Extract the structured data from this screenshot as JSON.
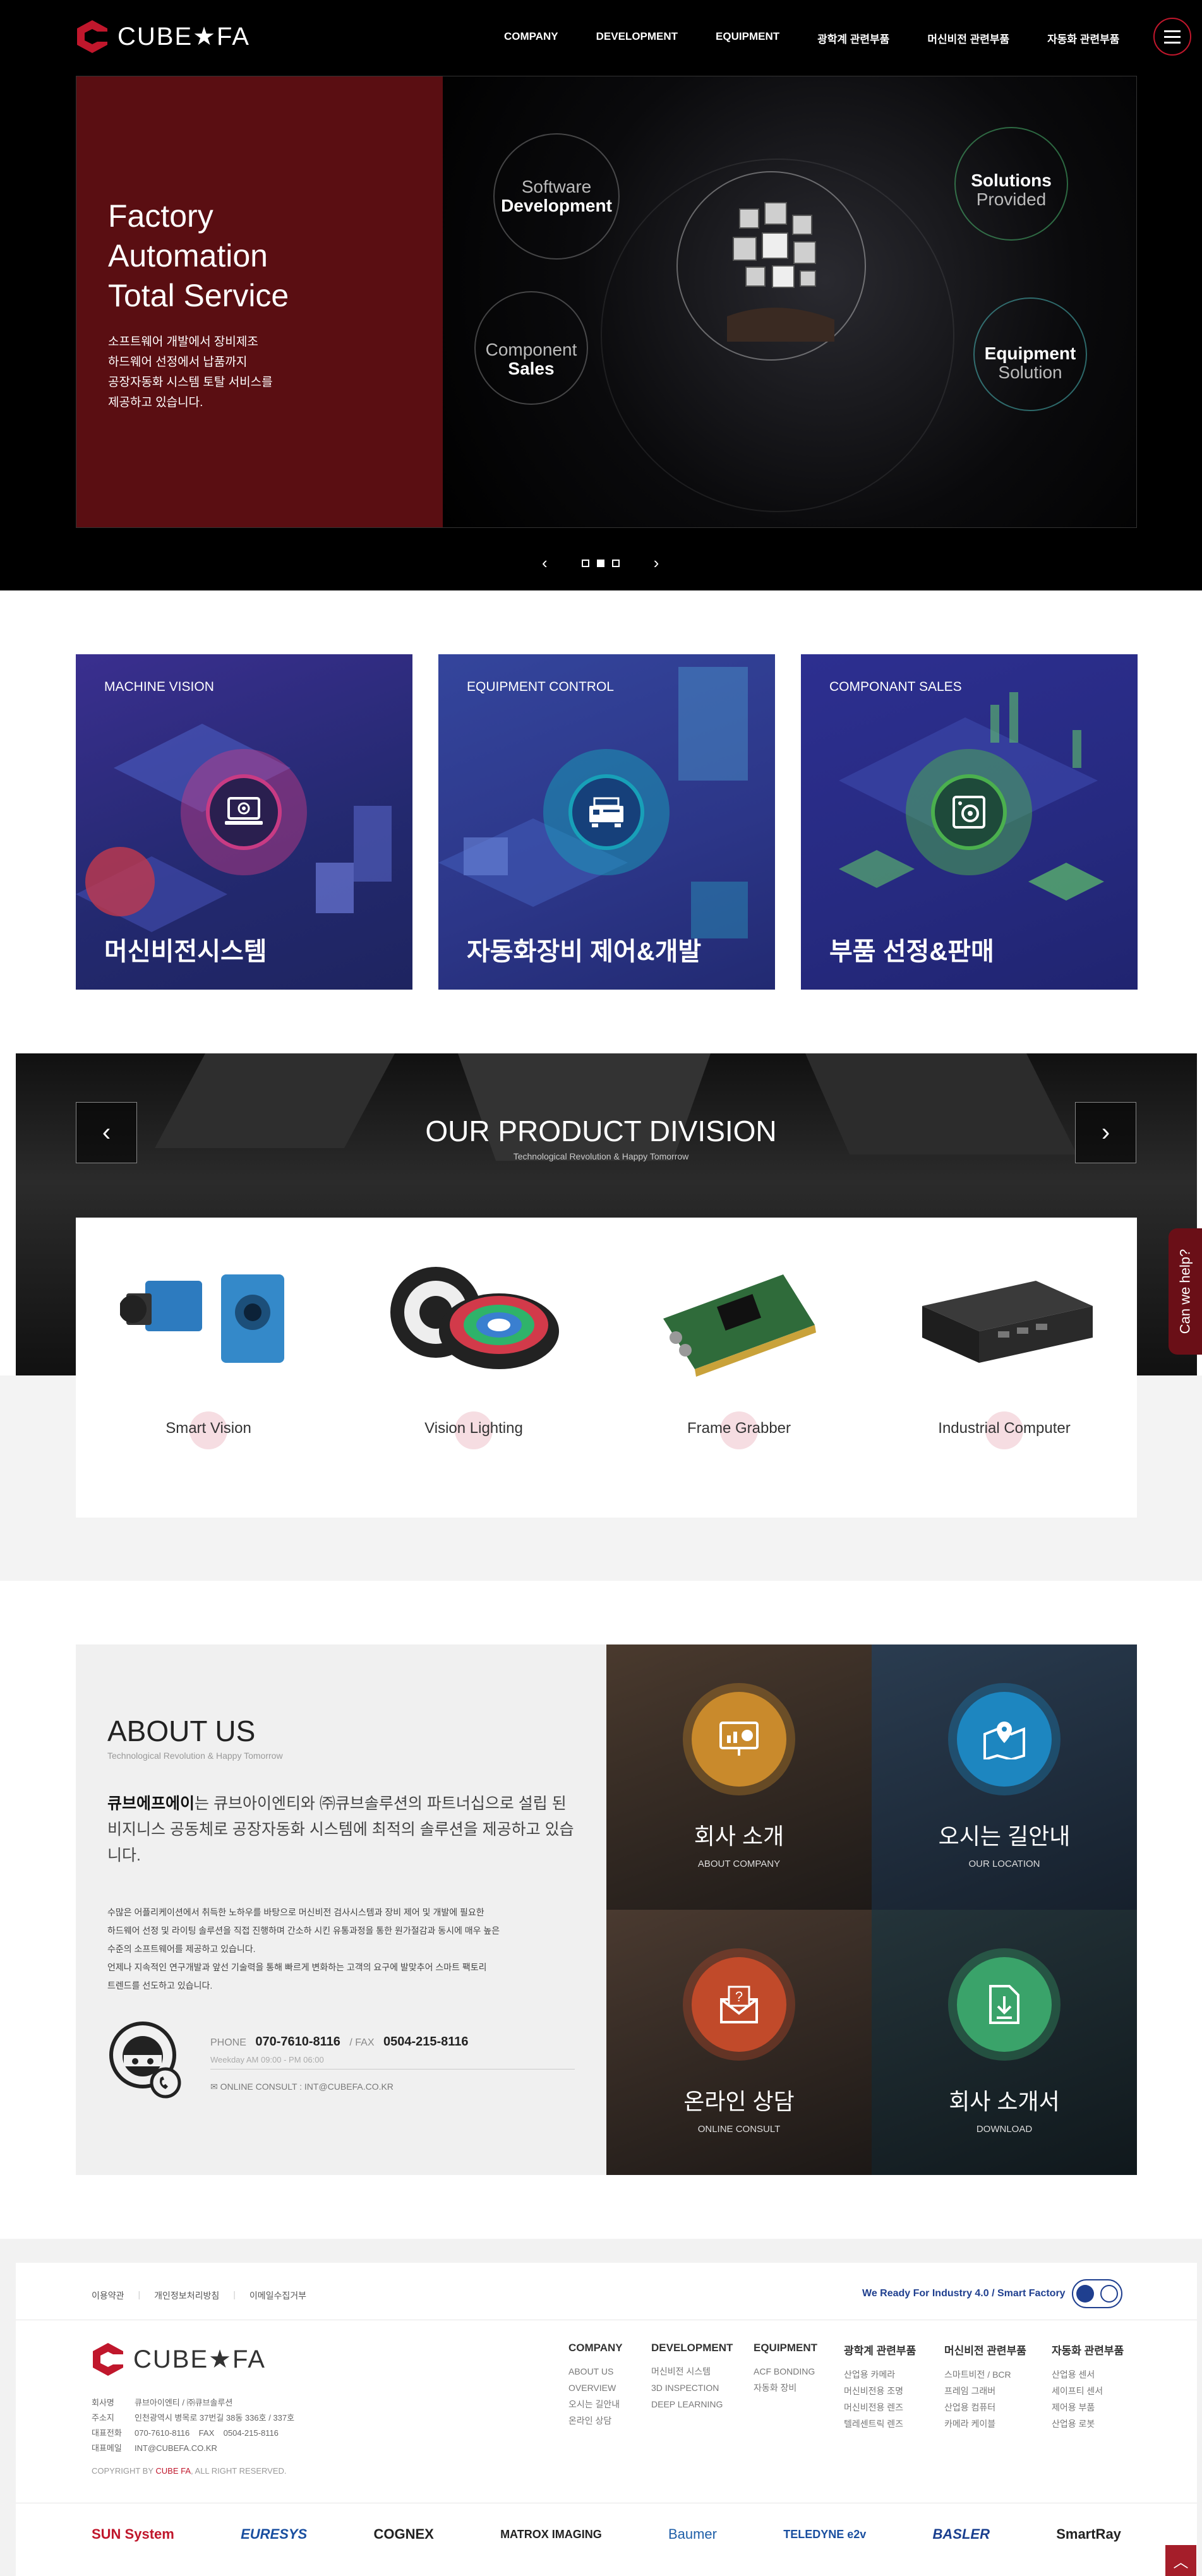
{
  "header": {
    "logo_text": "CUBE★FA",
    "nav": [
      "COMPANY",
      "DEVELOPMENT",
      "EQUIPMENT",
      "광학계 관련부품",
      "머신비전 관련부품",
      "자동화 관련부품"
    ]
  },
  "hero": {
    "title_lines": [
      "Factory",
      "Automation",
      "Total Service"
    ],
    "desc_lines": [
      "소프트웨어 개발에서 장비제조",
      "하드웨어 선정에서 납품까지",
      "공장자동화 시스템 토탈 서비스를",
      "제공하고 있습니다."
    ],
    "labels": {
      "software": {
        "light": "Software",
        "bold": "Development"
      },
      "solutions": {
        "light": "Solutions",
        "sub": "Provided"
      },
      "component": {
        "light": "Component",
        "bold": "Sales"
      },
      "equipment": {
        "light": "Equipment",
        "sub": "Solution"
      }
    },
    "slide_count": 3,
    "active_slide": 2
  },
  "services": [
    {
      "tag": "MACHINE VISION",
      "title": "머신비전시스템",
      "color": "#2a2f7e",
      "accent": "#c83b84"
    },
    {
      "tag": "EQUIPMENT CONTROL",
      "title": "자동화장비 제어&개발",
      "color": "#2d3a8c",
      "accent": "#18a0b8"
    },
    {
      "tag": "COMPONANT SALES",
      "title": "부품 선정&판매",
      "color": "#262c80",
      "accent": "#4bb04e"
    }
  ],
  "product_division": {
    "title": "OUR PRODUCT DIVISION",
    "subtitle": "Technological Revolution & Happy Tomorrow",
    "products": [
      "Smart Vision",
      "Vision Lighting",
      "Frame Grabber",
      "Industrial Computer"
    ]
  },
  "help_tab": "Can we help?",
  "about": {
    "title": "ABOUT US",
    "subtitle": "Technological Revolution & Happy Tomorrow",
    "lead_bold": "큐브에프에이",
    "lead_rest": "는 큐브아이엔티와 ㈜큐브솔루션의 파트너십으로 설립 된 비지니스 공동체로 공장자동화 시스템에 최적의 솔루션을 제공하고 있습니다.",
    "body_lines": [
      "수많은 어플리케이션에서 취득한 노하우를 바탕으로 머신비전 검사시스템과 장비 제어 및 개발에 필요한",
      "하드웨어 선정 및 라이팅 솔루션을 직접 진행하며 간소하 시킨 유통과정을 통한 원가절감과 동시에 매우 높은",
      "수준의 소프트웨어를 제공하고 있습니다.",
      "언제나 지속적인 연구개발과 앞선 기술력을 통해 빠르게 변화하는 고객의 요구에 발맞추어 스마트 팩토리",
      "트렌드를 선도하고 있습니다."
    ],
    "phone_label": "PHONE",
    "phone": "070-7610-8116",
    "fax_label": "/ FAX",
    "fax": "0504-215-8116",
    "hours": "Weekday AM 09:00 - PM 06:00",
    "consult": "ONLINE CONSULT : INT@CUBEFA.CO.KR",
    "tiles": [
      {
        "title": "회사 소개",
        "sub": "ABOUT COMPANY",
        "icon": "presentation-icon",
        "ring": "#c98a2c",
        "bg": "#3b2c20"
      },
      {
        "title": "오시는 길안내",
        "sub": "OUR LOCATION",
        "icon": "map-pin-icon",
        "ring": "#1d86c0",
        "bg": "#1c2c3d"
      },
      {
        "title": "온라인 상담",
        "sub": "ONLINE CONSULT",
        "icon": "mail-question-icon",
        "ring": "#c14a2a",
        "bg": "#3a2a22"
      },
      {
        "title": "회사 소개서",
        "sub": "DOWNLOAD",
        "icon": "download-file-icon",
        "ring": "#3aa36a",
        "bg": "#1d2c2a"
      }
    ]
  },
  "footer": {
    "links": [
      "이용약관",
      "개인정보처리방침",
      "이메일수집거부"
    ],
    "tagline": "We Ready For Industry 4.0 / Smart Factory",
    "logo_text": "CUBE★FA",
    "info": [
      {
        "k": "회사명",
        "v": "큐브아이엔티 / ㈜큐브솔루션"
      },
      {
        "k": "주소지",
        "v": "인천광역시 병목로 37번길 38동 336호 / 337호"
      },
      {
        "k": "대표전화",
        "v": "070-7610-8116    FAX    0504-215-8116"
      },
      {
        "k": "대표메일",
        "v": "INT@CUBEFA.CO.KR"
      }
    ],
    "copyright_pre": "COPYRIGHT BY ",
    "copyright_brand": "CUBE FA",
    "copyright_post": ", ALL RIGHT RESERVED.",
    "columns": [
      {
        "h": "COMPANY",
        "items": [
          "ABOUT US",
          "OVERVIEW",
          "오시는 길안내",
          "온라인 상담"
        ]
      },
      {
        "h": "DEVELOPMENT",
        "items": [
          "머신비전 시스템",
          "3D INSPECTION",
          "DEEP LEARNING"
        ]
      },
      {
        "h": "EQUIPMENT",
        "items": [
          "ACF BONDING",
          "자동화 장비"
        ]
      },
      {
        "h": "광학계 관련부품",
        "items": [
          "산업용 카메라",
          "머신비전용 조명",
          "머신비전용 렌즈",
          "텔레센트릭 렌즈"
        ]
      },
      {
        "h": "머신비전 관련부품",
        "items": [
          "스마트비전 / BCR",
          "프레임 그래버",
          "산업용 컴퓨터",
          "카메라 케이블"
        ]
      },
      {
        "h": "자동화 관련부품",
        "items": [
          "산업용 센서",
          "세이프티 센서",
          "제어용 부품",
          "산업용 로봇"
        ]
      }
    ],
    "partners": [
      {
        "name": "SUN System",
        "color": "#c0172c"
      },
      {
        "name": "EURESYS",
        "color": "#1a4fa0"
      },
      {
        "name": "COGNEX",
        "color": "#222222"
      },
      {
        "name": "MATROX IMAGING",
        "color": "#222222"
      },
      {
        "name": "Baumer",
        "color": "#1f5fa8"
      },
      {
        "name": "TELEDYNE e2v",
        "color": "#1a4fa0"
      },
      {
        "name": "BASLER",
        "color": "#1a3f8f"
      },
      {
        "name": "SmartRay",
        "color": "#222222"
      }
    ]
  }
}
